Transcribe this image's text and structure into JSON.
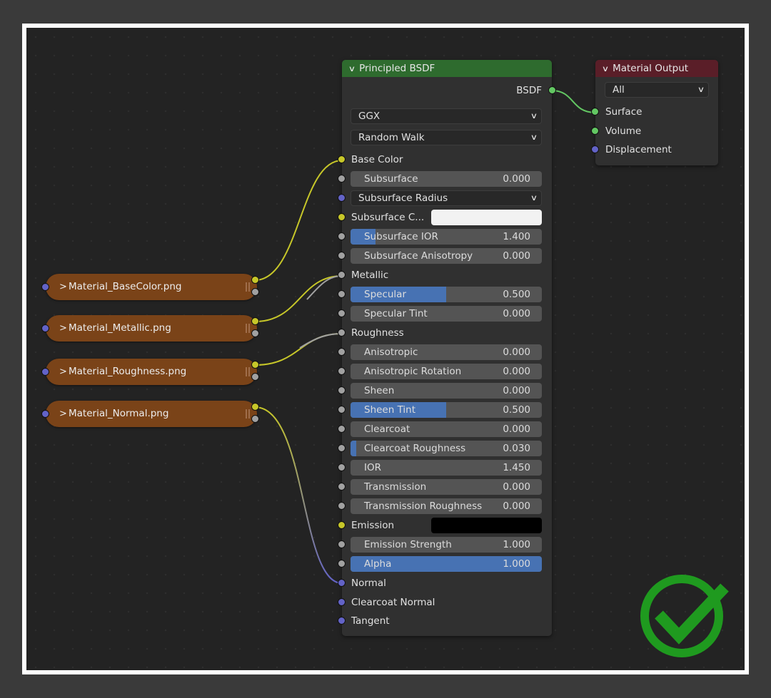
{
  "principled": {
    "title": "Principled BSDF",
    "output_label": "BSDF",
    "distribution": "GGX",
    "subsurface_method": "Random Walk",
    "inputs": {
      "base_color": "Base Color",
      "subsurface": {
        "label": "Subsurface",
        "value": "0.000",
        "fraction": 0.0
      },
      "subsurface_radius": "Subsurface Radius",
      "subsurface_color": {
        "label": "Subsurface C...",
        "color": "#f2f2f2"
      },
      "subsurface_ior": {
        "label": "Subsurface IOR",
        "value": "1.400",
        "fraction": 0.13
      },
      "subsurface_anisotropy": {
        "label": "Subsurface Anisotropy",
        "value": "0.000",
        "fraction": 0.0
      },
      "metallic": "Metallic",
      "specular": {
        "label": "Specular",
        "value": "0.500",
        "fraction": 0.5
      },
      "specular_tint": {
        "label": "Specular Tint",
        "value": "0.000",
        "fraction": 0.0
      },
      "roughness": "Roughness",
      "anisotropic": {
        "label": "Anisotropic",
        "value": "0.000",
        "fraction": 0.0
      },
      "anisotropic_rotation": {
        "label": "Anisotropic Rotation",
        "value": "0.000",
        "fraction": 0.0
      },
      "sheen": {
        "label": "Sheen",
        "value": "0.000",
        "fraction": 0.0
      },
      "sheen_tint": {
        "label": "Sheen Tint",
        "value": "0.500",
        "fraction": 0.5
      },
      "clearcoat": {
        "label": "Clearcoat",
        "value": "0.000",
        "fraction": 0.0
      },
      "clearcoat_roughness": {
        "label": "Clearcoat Roughness",
        "value": "0.030",
        "fraction": 0.03
      },
      "ior": {
        "label": "IOR",
        "value": "1.450",
        "fraction": 0.0
      },
      "transmission": {
        "label": "Transmission",
        "value": "0.000",
        "fraction": 0.0
      },
      "transmission_roughness": {
        "label": "Transmission Roughness",
        "value": "0.000",
        "fraction": 0.0
      },
      "emission": {
        "label": "Emission",
        "color": "#000000"
      },
      "emission_strength": {
        "label": "Emission Strength",
        "value": "1.000",
        "fraction": 0.0
      },
      "alpha": {
        "label": "Alpha",
        "value": "1.000",
        "fraction": 1.0
      },
      "normal": "Normal",
      "clearcoat_normal": "Clearcoat Normal",
      "tangent": "Tangent"
    }
  },
  "material_output": {
    "title": "Material Output",
    "target": "All",
    "inputs": {
      "surface": "Surface",
      "volume": "Volume",
      "displacement": "Displacement"
    }
  },
  "textures": [
    {
      "label": "Material_BaseColor.png"
    },
    {
      "label": "Material_Metallic.png"
    },
    {
      "label": "Material_Roughness.png"
    },
    {
      "label": "Material_Normal.png"
    }
  ],
  "colors": {
    "bsdf_header": "#2e6b2e",
    "output_header": "#5a1e28",
    "texture_node": "#7a4318",
    "slider_fill": "#4772b3",
    "socket_color": "#c7c729",
    "socket_float": "#a1a1a1",
    "socket_vector": "#6363c7",
    "socket_shader": "#63c763",
    "checkmark": "#1f9a1f"
  },
  "icons": {
    "collapse": "chevron-down-icon",
    "expand": "chevron-right-icon",
    "status": "checkmark-icon"
  }
}
